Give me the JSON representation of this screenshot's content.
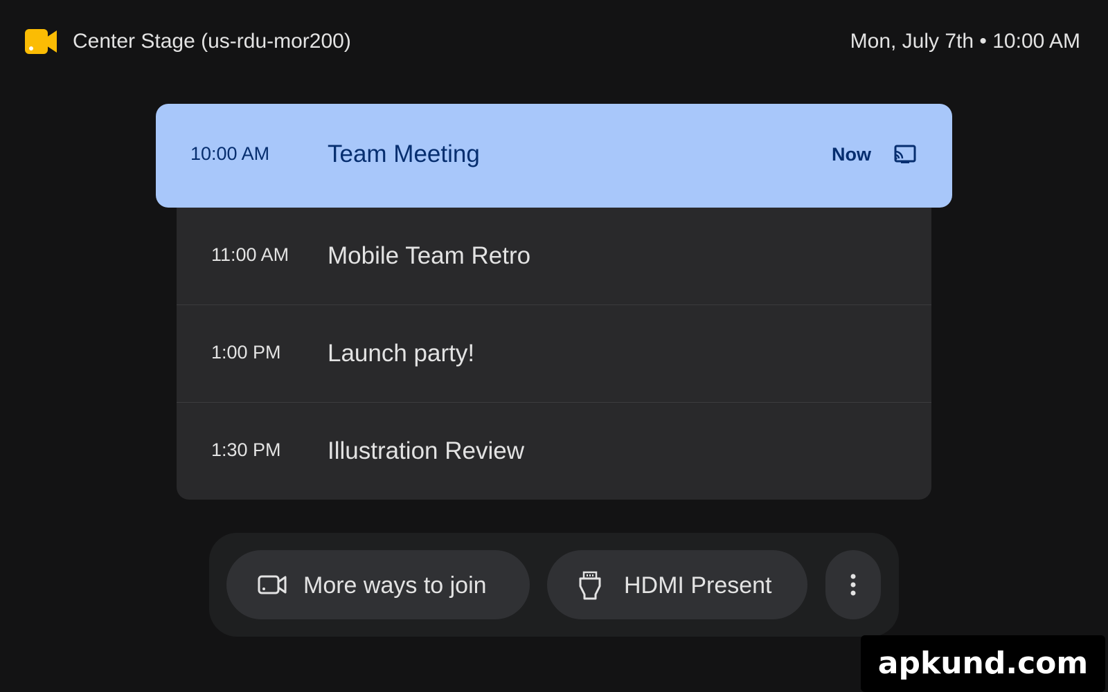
{
  "header": {
    "app_icon": "meet-camera-icon",
    "room_name": "Center Stage (us-rdu-mor200)",
    "datetime": "Mon, July 7th • 10:00 AM"
  },
  "current_meeting": {
    "time": "10:00 AM",
    "title": "Team Meeting",
    "status": "Now",
    "icon": "cast-icon"
  },
  "upcoming": [
    {
      "time": "11:00 AM",
      "title": "Mobile Team Retro"
    },
    {
      "time": "1:00 PM",
      "title": "Launch party!"
    },
    {
      "time": "1:30 PM",
      "title": "Illustration Review"
    }
  ],
  "actions": {
    "join": {
      "label": "More ways to join",
      "icon": "video-camera-icon"
    },
    "hdmi": {
      "label": "HDMI Present",
      "icon": "hdmi-icon"
    },
    "more": {
      "icon": "more-vert-icon"
    }
  },
  "watermark": "apkund.com",
  "colors": {
    "background": "#131314",
    "current_bg": "#a8c7fa",
    "current_text": "#062e6f",
    "list_bg": "#29292b",
    "accent_yellow": "#fbbc04"
  }
}
